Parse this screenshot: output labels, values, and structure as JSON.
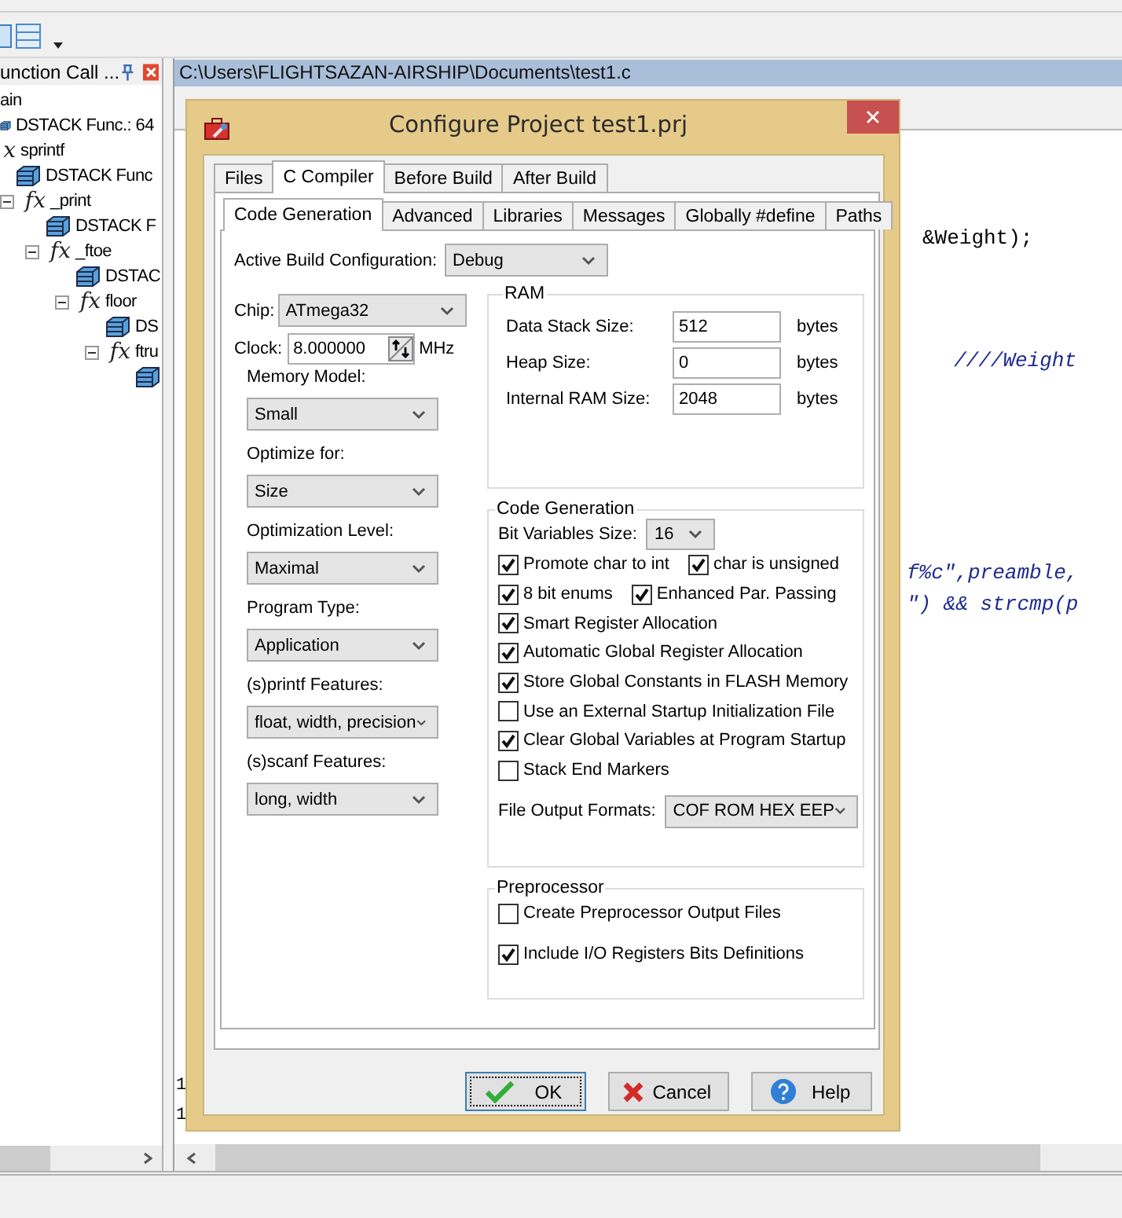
{
  "call_tree": {
    "title": "unction Call ...",
    "items": [
      {
        "label": "ain",
        "children": [
          {
            "kind": "stack",
            "label": "DSTACK Func.: 64"
          },
          {
            "kind": "function",
            "icon_text": "x",
            "label": "sprintf",
            "children": [
              {
                "kind": "stack",
                "label": "DSTACK Func"
              },
              {
                "kind": "function",
                "icon_text": "fx",
                "label": "_print",
                "expanded": true,
                "children": [
                  {
                    "kind": "stack",
                    "label": "DSTACK F"
                  },
                  {
                    "kind": "function",
                    "icon_text": "fx",
                    "label": "_ftoe",
                    "expanded": true,
                    "children": [
                      {
                        "kind": "stack",
                        "label": "DSTAC"
                      },
                      {
                        "kind": "function",
                        "icon_text": "fx",
                        "label": "floor",
                        "expanded": true,
                        "children": [
                          {
                            "kind": "stack",
                            "label": "DS"
                          },
                          {
                            "kind": "function",
                            "icon_text": "fx",
                            "label": "ftru",
                            "expanded": true,
                            "children": [
                              {
                                "kind": "stack"
                              }
                            ]
                          }
                        ]
                      }
                    ]
                  }
                ]
              }
            ]
          }
        ]
      }
    ]
  },
  "editor": {
    "path": "C:\\Users\\FLIGHTSAZAN-AIRSHIP\\Documents\\test1.c",
    "code_lines": [
      {
        "kind": "code",
        "text": "&Weight);"
      },
      {
        "kind": "comment",
        "text": "////Weight"
      },
      {
        "kind": "comment",
        "text": "f%c\",preamble,"
      },
      {
        "kind": "comment",
        "text": "\") && strcmp(p"
      }
    ],
    "line_numbers": [
      "1",
      "1"
    ]
  },
  "dialog": {
    "title": "Configure Project test1.prj",
    "tabs": [
      {
        "label": "Files",
        "selected": false
      },
      {
        "label": "C Compiler",
        "selected": true
      },
      {
        "label": "Before Build",
        "selected": false
      },
      {
        "label": "After Build",
        "selected": false
      }
    ],
    "subtabs": [
      {
        "label": "Code Generation",
        "selected": true
      },
      {
        "label": "Advanced",
        "selected": false
      },
      {
        "label": "Libraries",
        "selected": false
      },
      {
        "label": "Messages",
        "selected": false
      },
      {
        "label": "Globally #define",
        "selected": false
      },
      {
        "label": "Paths",
        "selected": false
      }
    ],
    "active_build_configuration": {
      "label": "Active Build Configuration:",
      "value": "Debug"
    },
    "chip": {
      "label": "Chip:",
      "value": "ATmega32"
    },
    "clock": {
      "label": "Clock:",
      "value": "8.000000",
      "unit": "MHz"
    },
    "options": [
      {
        "label": "Memory Model:",
        "value": "Small"
      },
      {
        "label": "Optimize for:",
        "value": "Size"
      },
      {
        "label": "Optimization Level:",
        "value": "Maximal"
      },
      {
        "label": "Program Type:",
        "value": "Application"
      },
      {
        "label": "(s)printf Features:",
        "value": "float, width, precision"
      },
      {
        "label": "(s)scanf Features:",
        "value": "long, width"
      }
    ],
    "ram": {
      "title": "RAM",
      "fields": [
        {
          "label": "Data Stack Size:",
          "value": "512",
          "unit": "bytes"
        },
        {
          "label": "Heap Size:",
          "value": "0",
          "unit": "bytes"
        },
        {
          "label": "Internal RAM Size:",
          "value": "2048",
          "unit": "bytes"
        }
      ]
    },
    "code_generation": {
      "title": "Code Generation",
      "bit_variables_size": {
        "label": "Bit Variables Size:",
        "value": "16"
      },
      "rows": [
        [
          {
            "label": "Promote char to int",
            "checked": true
          },
          {
            "label": "char is unsigned",
            "checked": true
          }
        ],
        [
          {
            "label": "8 bit enums",
            "checked": true
          },
          {
            "label": "Enhanced Par. Passing",
            "checked": true
          }
        ],
        [
          {
            "label": "Smart Register Allocation",
            "checked": true
          }
        ],
        [
          {
            "label": "Automatic Global Register Allocation",
            "checked": true
          }
        ],
        [
          {
            "label": "Store Global Constants in FLASH Memory",
            "checked": true
          }
        ],
        [
          {
            "label": "Use an External Startup Initialization File",
            "checked": false
          }
        ],
        [
          {
            "label": "Clear Global Variables at Program Startup",
            "checked": true
          }
        ],
        [
          {
            "label": "Stack End Markers",
            "checked": false
          }
        ]
      ],
      "file_output_formats": {
        "label": "File Output Formats:",
        "value": "COF ROM HEX EEP"
      }
    },
    "preprocessor": {
      "title": "Preprocessor",
      "checkboxes": [
        {
          "label": "Create Preprocessor Output Files",
          "checked": false
        },
        {
          "label": "Include I/O Registers Bits Definitions",
          "checked": true
        }
      ]
    },
    "buttons": [
      {
        "kind": "ok",
        "label": "OK",
        "focused": true
      },
      {
        "kind": "cancel",
        "label": "Cancel",
        "focused": false
      },
      {
        "kind": "help",
        "label": "Help",
        "focused": false
      }
    ]
  }
}
